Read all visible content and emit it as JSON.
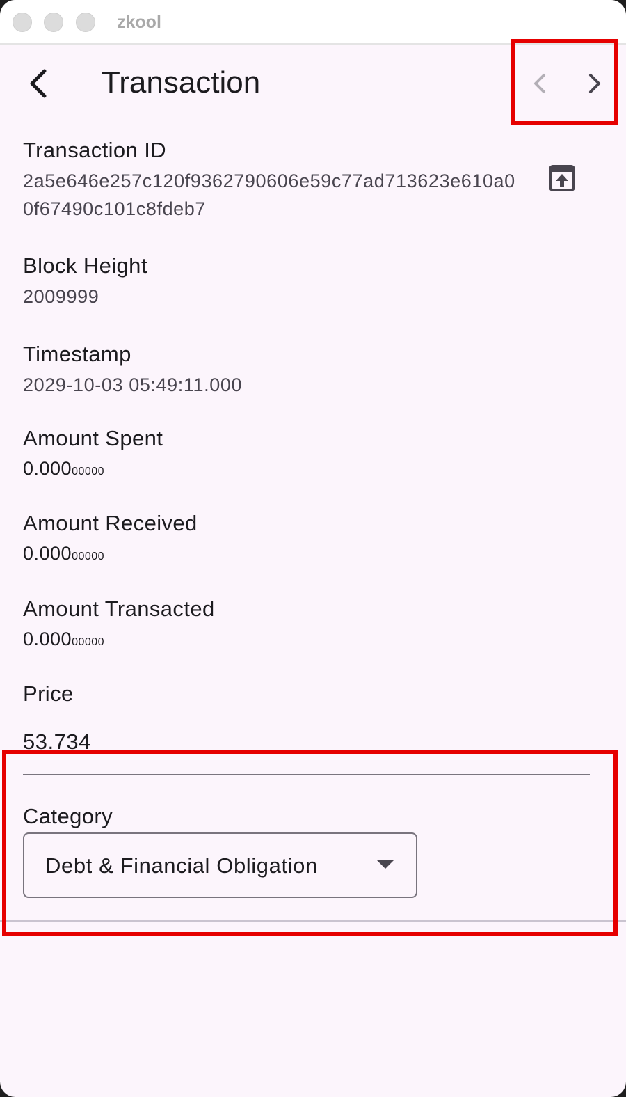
{
  "window": {
    "title": "zkool"
  },
  "appbar": {
    "title": "Transaction",
    "back_icon": "arrow-back-icon",
    "prev_icon": "chevron-left-icon",
    "next_icon": "chevron-right-icon"
  },
  "fields": {
    "txid": {
      "label": "Transaction ID",
      "value": "2a5e646e257c120f9362790606e59c77ad713623e610a00f67490c101c8fdeb7",
      "action_icon": "open-in-browser-icon"
    },
    "height": {
      "label": "Block Height",
      "value": "2009999"
    },
    "timestamp": {
      "label": "Timestamp",
      "value": "2029-10-03 05:49:11.000"
    },
    "spent": {
      "label": "Amount Spent",
      "main": "0.000",
      "small": "00000"
    },
    "received": {
      "label": "Amount Received",
      "main": "0.000",
      "small": "00000"
    },
    "transacted": {
      "label": "Amount Transacted",
      "main": "0.000",
      "small": "00000"
    },
    "price": {
      "label": "Price",
      "value": "53.734"
    }
  },
  "category": {
    "label": "Category",
    "selected": "Debt & Financial Obligation",
    "dropdown_icon": "dropdown-arrow-icon"
  },
  "colors": {
    "background": "#fcf5fc",
    "highlight": "#e60000",
    "text": "#1c1b1f",
    "secondary_text": "#49454f"
  }
}
